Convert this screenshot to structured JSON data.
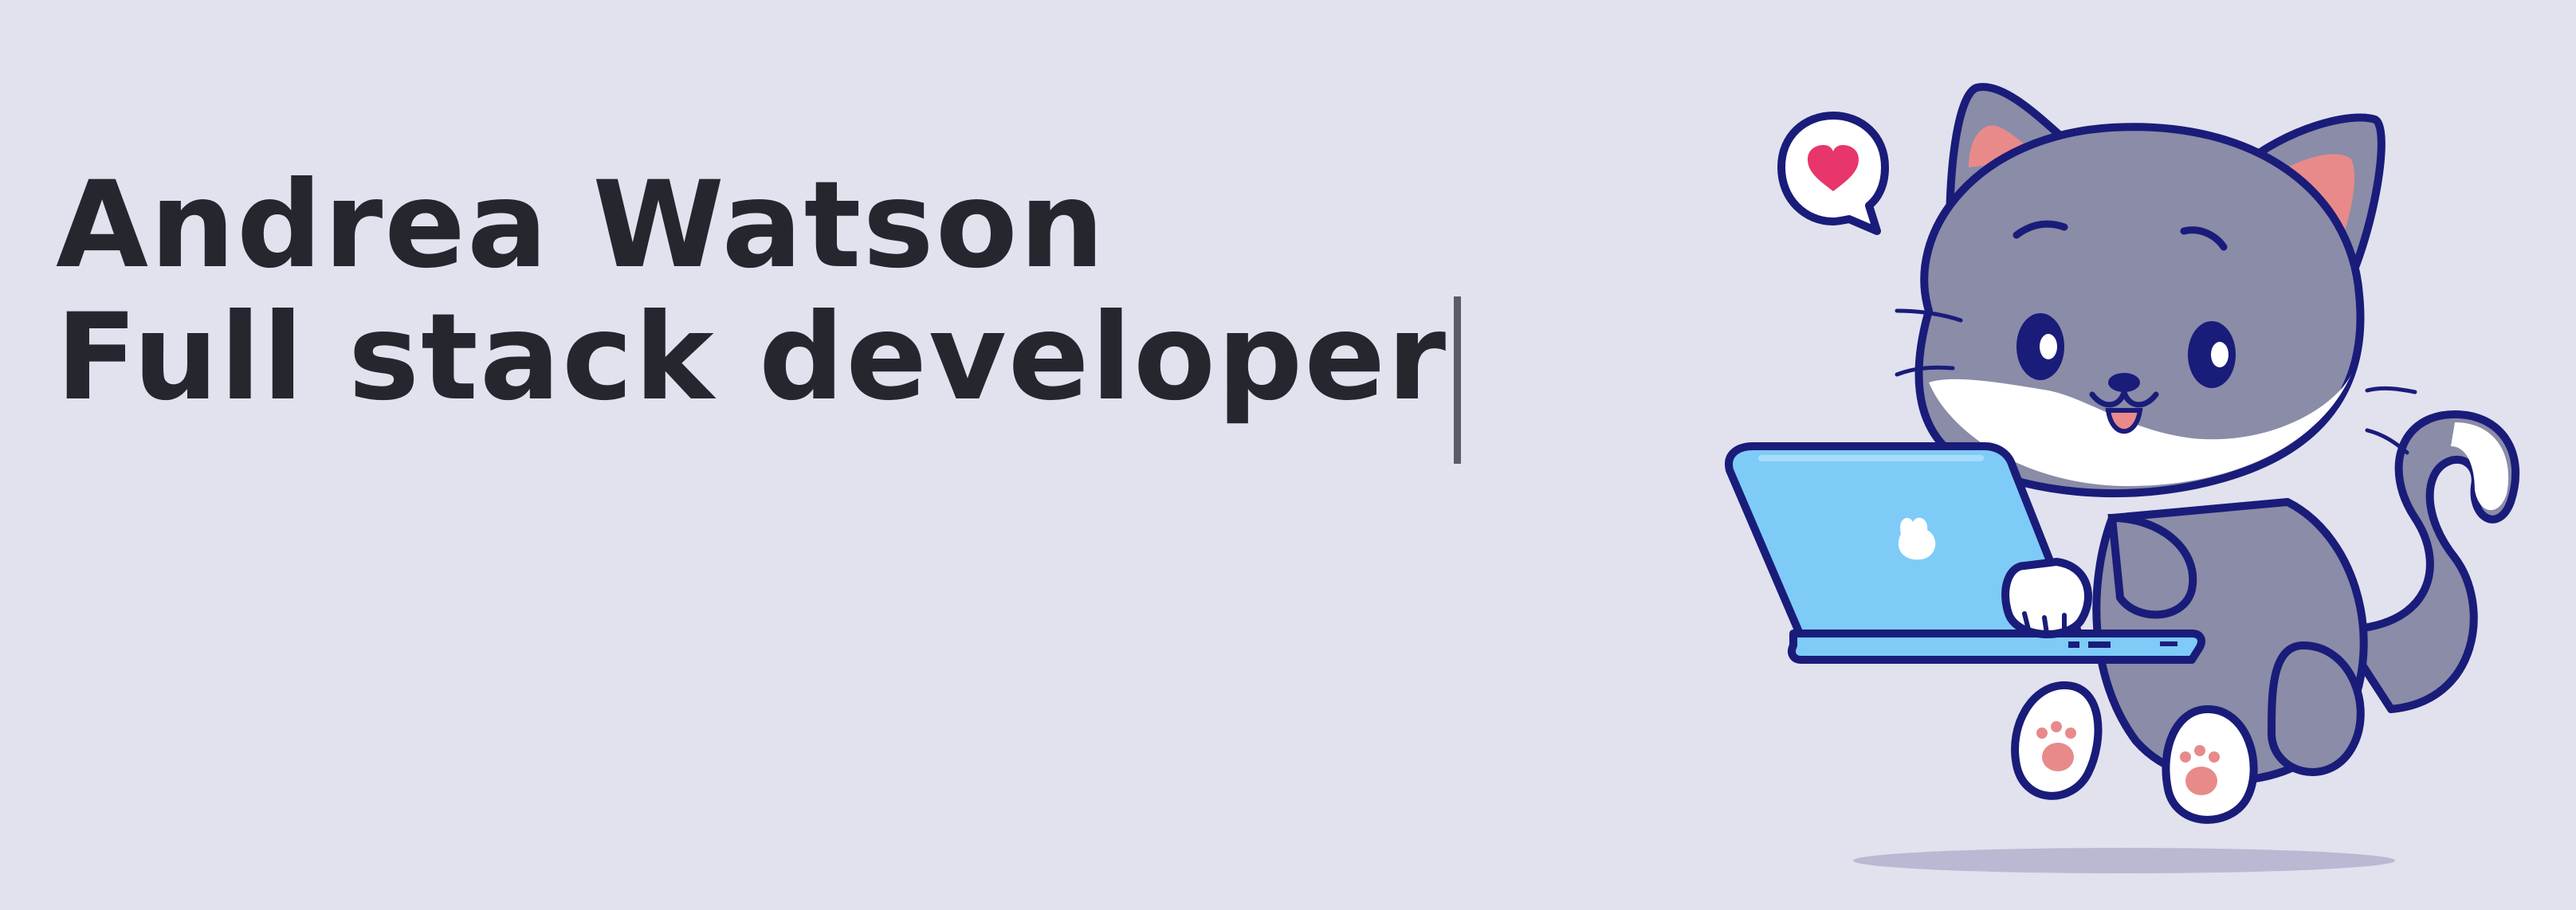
{
  "hero": {
    "name": "Andrea Watson",
    "role": "Full stack developer"
  },
  "illustration": {
    "subject": "cat-using-laptop",
    "speech_bubble_icon": "heart-icon"
  },
  "colors": {
    "background": "#e1e2ee",
    "text": "#25272e",
    "outline": "#1a1c7a",
    "cat_body": "#8a8ca8",
    "cat_white": "#ffffff",
    "laptop_screen": "#7ecbf7",
    "heart": "#e8356b",
    "paw_pads": "#e88a8a"
  }
}
